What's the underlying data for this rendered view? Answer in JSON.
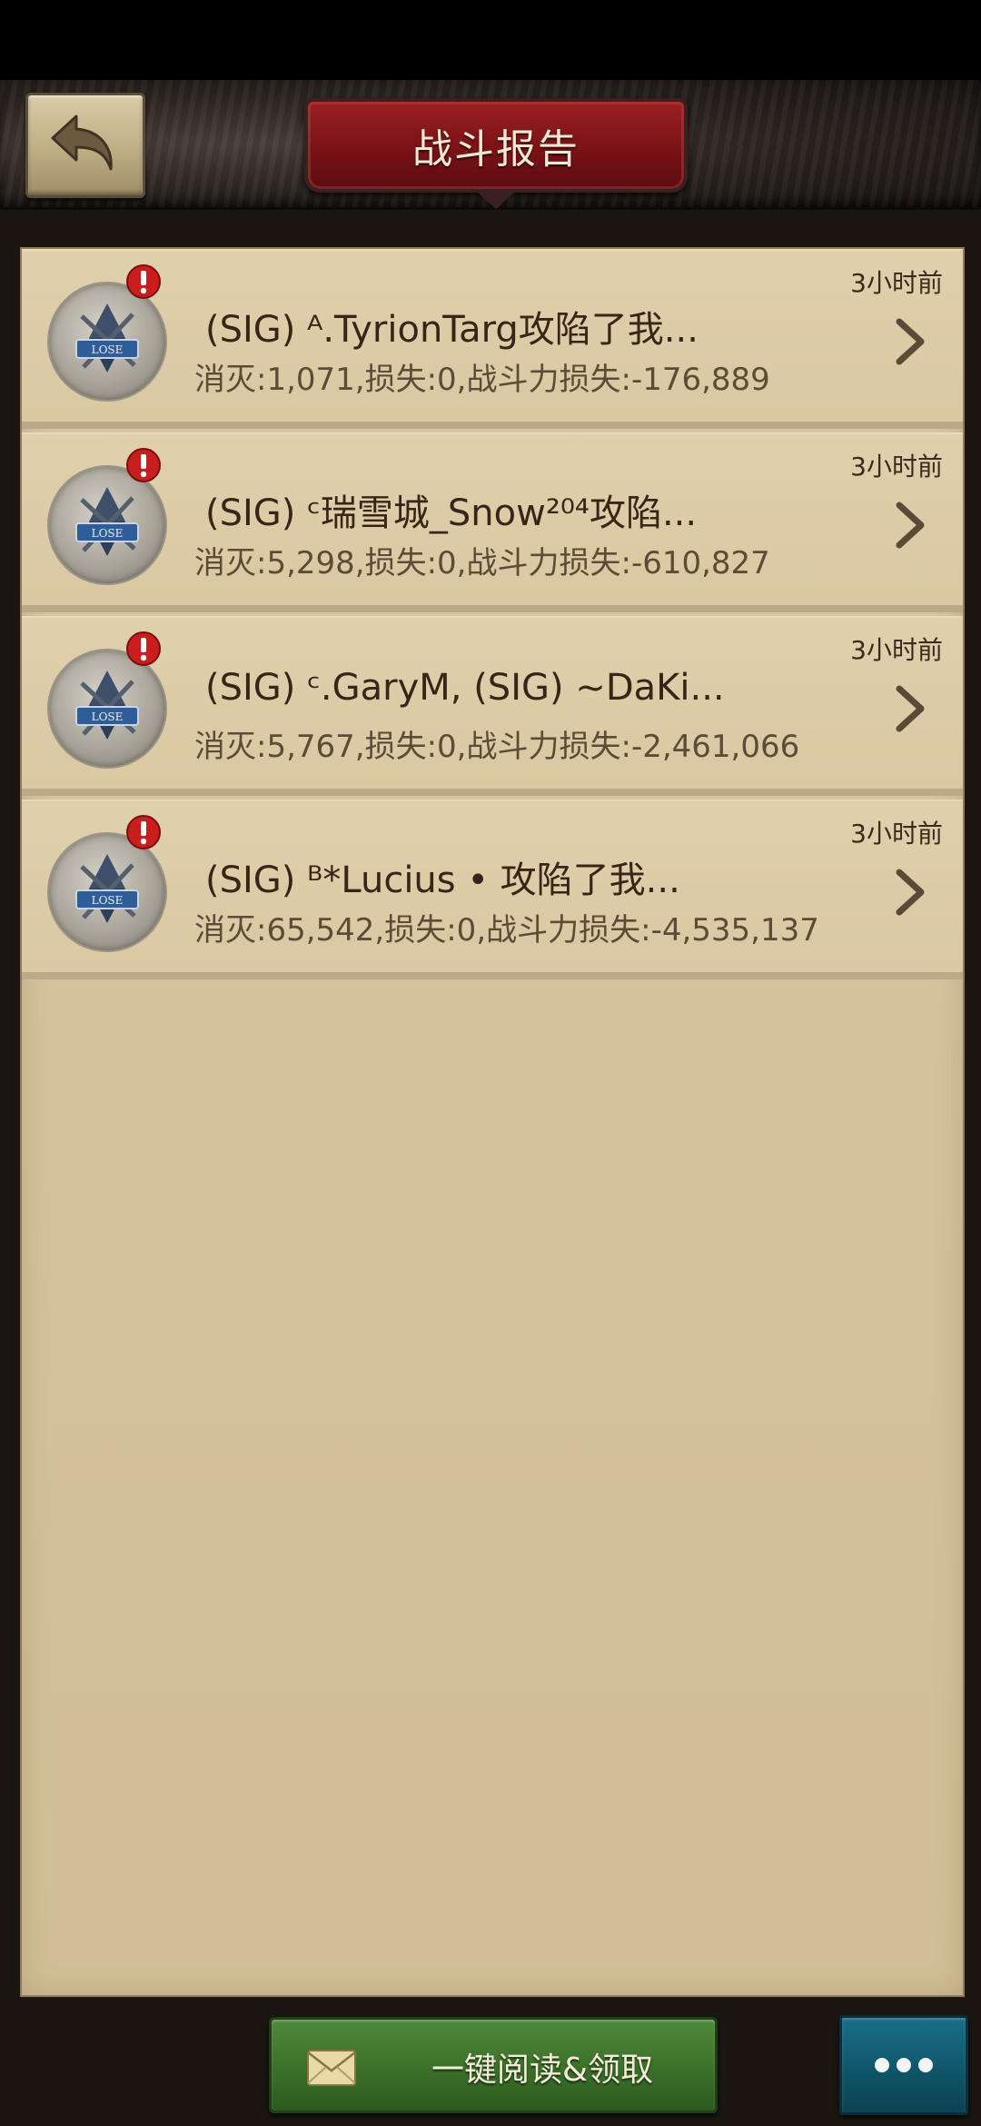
{
  "header": {
    "title": "战斗报告",
    "back_icon": "back-arrow-icon"
  },
  "reports": [
    {
      "title": "(SIG) ᴬ.TyrionTarg攻陷了我...",
      "stats": "消灭:1,071,损失:0,战斗力损失:-176,889",
      "time": "3小时前",
      "result_icon": "lose-emblem-icon",
      "unread": true
    },
    {
      "title": "(SIG) ᶜ瑞雪城_Snow²⁰⁴攻陷...",
      "stats": "消灭:5,298,损失:0,战斗力损失:-610,827",
      "time": "3小时前",
      "result_icon": "lose-emblem-icon",
      "unread": true
    },
    {
      "title": "(SIG) ᶜ.GaryM, (SIG) ~DaKi...",
      "stats": "消灭:5,767,损失:0,战斗力损失:-2,461,066",
      "time": "3小时前",
      "result_icon": "lose-emblem-icon",
      "unread": true
    },
    {
      "title": "(SIG) ᴮ*Lucius • 攻陷了我...",
      "stats": "消灭:65,542,损失:0,战斗力损失:-4,535,137",
      "time": "3小时前",
      "result_icon": "lose-emblem-icon",
      "unread": true
    }
  ],
  "footer": {
    "read_all_label": "一键阅读&领取",
    "read_all_icon": "envelope-icon",
    "more_icon": "more-dots-icon"
  },
  "colors": {
    "title_plate": "#7a1216",
    "read_all_button": "#3b7029",
    "more_button": "#0f566a",
    "parchment": "#d7c6a1",
    "alert": "#c81e1e"
  }
}
